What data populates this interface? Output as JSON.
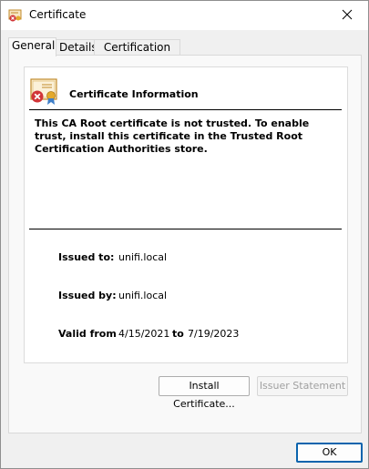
{
  "window": {
    "title": "Certificate"
  },
  "tabs": [
    {
      "label": "General"
    },
    {
      "label": "Details"
    },
    {
      "label": "Certification Path"
    }
  ],
  "certificate": {
    "heading": "Certificate Information",
    "message": "This CA Root certificate is not trusted. To enable trust, install this certificate in the Trusted Root Certification Authorities store.",
    "issued_to_label": "Issued to:",
    "issued_to": "unifi.local",
    "issued_by_label": "Issued by:",
    "issued_by": "unifi.local",
    "valid_from_label": "Valid from",
    "valid_from": "4/15/2021",
    "to_label": "to",
    "valid_to": "7/19/2023"
  },
  "buttons": {
    "install": "Install Certificate...",
    "issuer_statement": "Issuer Statement",
    "ok": "OK"
  },
  "icons": {
    "title": "certificate-icon",
    "close": "close-icon",
    "cert_status": "certificate-error-icon"
  },
  "colors": {
    "accent": "#0a64ad",
    "error": "#d13438"
  }
}
